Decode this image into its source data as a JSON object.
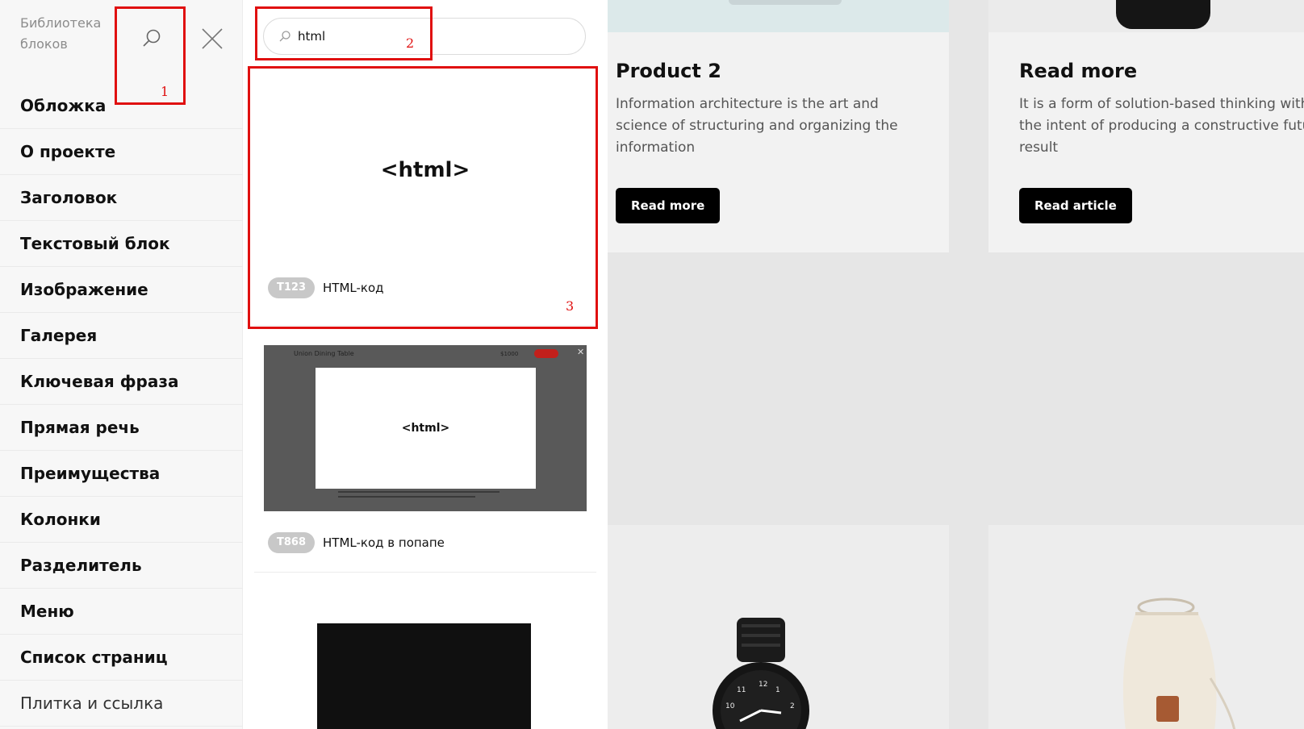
{
  "sidebar": {
    "title": "Библиотека блоков",
    "items": [
      {
        "label": "Обложка"
      },
      {
        "label": "О проекте"
      },
      {
        "label": "Заголовок"
      },
      {
        "label": "Текстовый блок"
      },
      {
        "label": "Изображение"
      },
      {
        "label": "Галерея"
      },
      {
        "label": "Ключевая фраза"
      },
      {
        "label": "Прямая речь"
      },
      {
        "label": "Преимущества"
      },
      {
        "label": "Колонки"
      },
      {
        "label": "Разделитель"
      },
      {
        "label": "Меню"
      },
      {
        "label": "Список страниц"
      },
      {
        "label": "Плитка и ссылка"
      }
    ]
  },
  "search": {
    "value": "html"
  },
  "results": [
    {
      "code": "T123",
      "name": "HTML-код",
      "preview_text": "<html>"
    },
    {
      "code": "T868",
      "name": "HTML-код в попапе",
      "preview_text": "<html>",
      "preview_header": "Union Dining Table",
      "preview_price": "$1000"
    }
  ],
  "annotations": [
    "1",
    "2",
    "3"
  ],
  "canvas": {
    "tiles": [
      {
        "title": "Product 2",
        "text_lines": [
          "Information architecture is the art and",
          "science of structuring and organizing the",
          "information"
        ],
        "button": "Read more"
      },
      {
        "title": "Read more",
        "text_lines": [
          "It is a form of solution-based thinking with",
          "the intent of producing a constructive futu",
          "result"
        ],
        "button": "Read article"
      }
    ]
  },
  "colors": {
    "annotation": "#e01010",
    "badge": "#c8c8c8",
    "button": "#000000"
  }
}
